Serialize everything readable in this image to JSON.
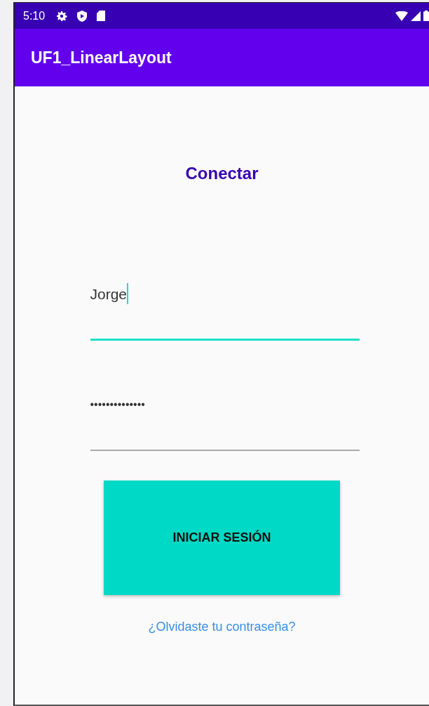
{
  "status_bar": {
    "time": "5:10"
  },
  "app_bar": {
    "title": "UF1_LinearLayout"
  },
  "heading": "Conectar",
  "fields": [
    {
      "kind": "text",
      "value": "Jorge",
      "focused": true
    },
    {
      "kind": "password",
      "value": "••••••••••••••",
      "focused": false
    }
  ],
  "button": {
    "label": "INICIAR SESIÓN"
  },
  "link": "¿Olvidaste tu contraseña?"
}
